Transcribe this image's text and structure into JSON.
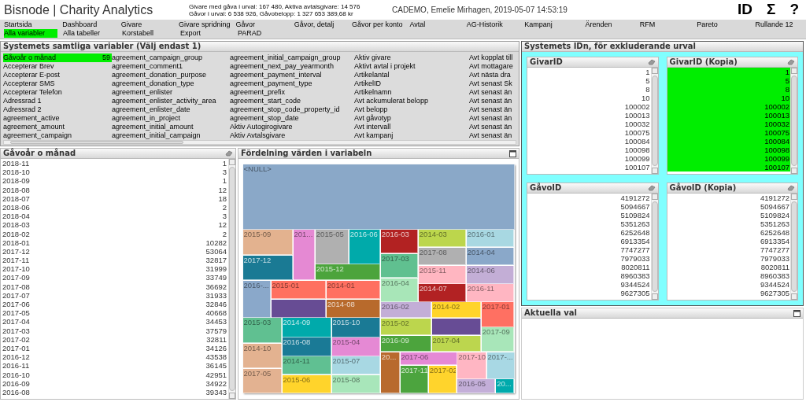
{
  "app": {
    "title": "Bisnode | Charity Analytics",
    "stats": [
      "Givare med gåva i urval: 167 480, Aktiva avtalsgivare: 14 576",
      "Gåvor i urval: 6 538 926, Gåvobelopp: 1 327 653 389,68 kr"
    ],
    "user": "CADEMO, Emelie Mirhagen, 2019-05-07 14:53:19",
    "tools": [
      "ID",
      "Σ",
      "?"
    ]
  },
  "menu": [
    [
      {
        "label": "Startsida",
        "selected": false
      },
      {
        "label": "Dashboard",
        "selected": false
      },
      {
        "label": "Givare",
        "selected": false
      },
      {
        "label": "Givare spridning",
        "selected": false
      },
      {
        "label": "Gåvor",
        "selected": false
      },
      {
        "label": "Gåvor, detalj",
        "selected": false
      },
      {
        "label": "Gåvor per konto",
        "selected": false
      },
      {
        "label": "Avtal",
        "selected": false
      },
      {
        "label": "AG-Historik",
        "selected": false
      },
      {
        "label": "Kampanj",
        "selected": false
      },
      {
        "label": "Ärenden",
        "selected": false
      },
      {
        "label": "RFM",
        "selected": false
      },
      {
        "label": "Pareto",
        "selected": false
      },
      {
        "label": "Rullande 12",
        "selected": false
      }
    ],
    [
      {
        "label": "Alla variabler",
        "selected": true
      },
      {
        "label": "Alla tabeller",
        "selected": false
      },
      {
        "label": "Korstabell",
        "selected": false
      },
      {
        "label": "Export",
        "selected": false
      },
      {
        "label": "PARAD",
        "selected": false
      }
    ]
  ],
  "variables": {
    "title": "Systemets samtliga variabler (Välj endast 1)",
    "columns": [
      [
        {
          "label": "Gåvoår o månad",
          "count": "59",
          "selected": true
        },
        {
          "label": "Accepterar Brev",
          "selected": false
        },
        {
          "label": "Accepterar E-post",
          "selected": false
        },
        {
          "label": "Accepterar SMS",
          "selected": false
        },
        {
          "label": "Accepterar Telefon",
          "selected": false
        },
        {
          "label": "Adressrad 1",
          "selected": false
        },
        {
          "label": "Adressrad 2",
          "selected": false
        },
        {
          "label": "agreement_active",
          "selected": false
        },
        {
          "label": "agreement_amount",
          "selected": false
        },
        {
          "label": "agreement_campaign",
          "selected": false
        }
      ],
      [
        {
          "label": "agreement_campaign_group",
          "selected": false
        },
        {
          "label": "agreement_comment1",
          "selected": false
        },
        {
          "label": "agreement_donation_purpose",
          "selected": false
        },
        {
          "label": "agreement_donation_type",
          "selected": false
        },
        {
          "label": "agreement_enlister",
          "selected": false
        },
        {
          "label": "agreement_enlister_activity_area",
          "selected": false
        },
        {
          "label": "agreement_enlister_date",
          "selected": false
        },
        {
          "label": "agreement_in_project",
          "selected": false
        },
        {
          "label": "agreement_initial_amount",
          "selected": false
        },
        {
          "label": "agreement_initial_campaign",
          "selected": false
        }
      ],
      [
        {
          "label": "agreement_initial_campaign_group",
          "selected": false
        },
        {
          "label": "agreement_next_pay_yearmonth",
          "selected": false
        },
        {
          "label": "agreement_payment_interval",
          "selected": false
        },
        {
          "label": "agreement_payment_type",
          "selected": false
        },
        {
          "label": "agreement_prefix",
          "selected": false
        },
        {
          "label": "agreement_start_code",
          "selected": false
        },
        {
          "label": "agreement_stop_code_property_id",
          "selected": false
        },
        {
          "label": "agreement_stop_date",
          "selected": false
        },
        {
          "label": "Aktiv Autogirogivare",
          "selected": false
        },
        {
          "label": "Aktiv Avtalsgivare",
          "selected": false
        }
      ],
      [
        {
          "label": "Aktiv givare",
          "selected": false
        },
        {
          "label": "Aktivt avtal i projekt",
          "selected": false
        },
        {
          "label": "Artikelantal",
          "selected": false
        },
        {
          "label": "ArtikelID",
          "selected": false
        },
        {
          "label": "Artikelnamn",
          "selected": false
        },
        {
          "label": "Avt ackumulerat belopp",
          "selected": false
        },
        {
          "label": "Avt belopp",
          "selected": false
        },
        {
          "label": "Avt gåvotyp",
          "selected": false
        },
        {
          "label": "Avt intervall",
          "selected": false
        },
        {
          "label": "Avt kampanj",
          "selected": false
        }
      ],
      [
        {
          "label": "Avt kopplat till",
          "selected": false
        },
        {
          "label": "Avt mottagare",
          "selected": false
        },
        {
          "label": "Avt nästa dra",
          "selected": false
        },
        {
          "label": "Avt senast Sk",
          "selected": false
        },
        {
          "label": "Avt senast än",
          "selected": false
        },
        {
          "label": "Avt senast än",
          "selected": false
        },
        {
          "label": "Avt senast än",
          "selected": false
        },
        {
          "label": "Avt senast än",
          "selected": false
        },
        {
          "label": "Avt senast än",
          "selected": false
        },
        {
          "label": "Avt senast än",
          "selected": false
        }
      ]
    ]
  },
  "month_list": {
    "title": "Gåvoår o månad",
    "rows": [
      {
        "label": "2018-11",
        "count": "1",
        "selected": false
      },
      {
        "label": "2018-10",
        "count": "3",
        "selected": false
      },
      {
        "label": "2018-09",
        "count": "1",
        "selected": false
      },
      {
        "label": "2018-08",
        "count": "12",
        "selected": false
      },
      {
        "label": "2018-07",
        "count": "18",
        "selected": false
      },
      {
        "label": "2018-06",
        "count": "2",
        "selected": false
      },
      {
        "label": "2018-04",
        "count": "3",
        "selected": false
      },
      {
        "label": "2018-03",
        "count": "12",
        "selected": false
      },
      {
        "label": "2018-02",
        "count": "2",
        "selected": false
      },
      {
        "label": "2018-01",
        "count": "10282",
        "selected": false
      },
      {
        "label": "2017-12",
        "count": "53064",
        "selected": false
      },
      {
        "label": "2017-11",
        "count": "32817",
        "selected": false
      },
      {
        "label": "2017-10",
        "count": "31999",
        "selected": false
      },
      {
        "label": "2017-09",
        "count": "33749",
        "selected": false
      },
      {
        "label": "2017-08",
        "count": "36692",
        "selected": false
      },
      {
        "label": "2017-07",
        "count": "31933",
        "selected": false
      },
      {
        "label": "2017-06",
        "count": "32846",
        "selected": false
      },
      {
        "label": "2017-05",
        "count": "40668",
        "selected": false
      },
      {
        "label": "2017-04",
        "count": "34453",
        "selected": false
      },
      {
        "label": "2017-03",
        "count": "37579",
        "selected": false
      },
      {
        "label": "2017-02",
        "count": "32811",
        "selected": false
      },
      {
        "label": "2017-01",
        "count": "34126",
        "selected": false
      },
      {
        "label": "2016-12",
        "count": "43538",
        "selected": false
      },
      {
        "label": "2016-11",
        "count": "36145",
        "selected": false
      },
      {
        "label": "2016-10",
        "count": "42951",
        "selected": false
      },
      {
        "label": "2016-09",
        "count": "34922",
        "selected": false
      },
      {
        "label": "2016-08",
        "count": "39343",
        "selected": false
      }
    ]
  },
  "treemap": {
    "title": "Fördelning värden i variabeln",
    "tiles": [
      {
        "label": "<NULL>",
        "color": "#8aa8c8"
      },
      {
        "label": "2015-09",
        "color": "#e3b28f"
      },
      {
        "label": "201...",
        "color": "#e589d3"
      },
      {
        "label": "2015-05",
        "color": "#b0b0b0"
      },
      {
        "label": "2016-06",
        "color": "#00aaaa"
      },
      {
        "label": "2016-03",
        "color": "#b22222"
      },
      {
        "label": "2014-03",
        "color": "#bcd64c"
      },
      {
        "label": "2016-01",
        "color": "#a8d8e2"
      },
      {
        "label": "2017-12",
        "color": "#1a7a94"
      },
      {
        "label": "2015-12",
        "color": "#4ca43c"
      },
      {
        "label": "2017-03",
        "color": "#60c090"
      },
      {
        "label": "2017-08",
        "color": "#b0b0b1"
      },
      {
        "label": "2014-04",
        "color": "#8aa8c9"
      },
      {
        "label": "2015-11",
        "color": "#ffb6c1"
      },
      {
        "label": "2014-06",
        "color": "#c3aed6"
      },
      {
        "label": "2016-...",
        "color": "#8aa8ca"
      },
      {
        "label": "2015-01",
        "color": "#ff7060"
      },
      {
        "label": "2014-01",
        "color": "#ff7061"
      },
      {
        "label": "2016-04",
        "color": "#a8e6b8"
      },
      {
        "label": "2014-07",
        "color": "#b22223"
      },
      {
        "label": "2016-11",
        "color": "#ffb6c2"
      },
      {
        "color": "#674c94"
      },
      {
        "label": "2014-08",
        "color": "#b86a2c"
      },
      {
        "label": "2016-02",
        "color": "#c3aed7"
      },
      {
        "label": "2014-02",
        "color": "#ffd42a"
      },
      {
        "label": "2017-01",
        "color": "#ff7062"
      },
      {
        "label": "2015-03",
        "color": "#60c091"
      },
      {
        "label": "2014-09",
        "color": "#00aaab"
      },
      {
        "label": "2015-10",
        "color": "#1a7a95"
      },
      {
        "label": "2015-02",
        "color": "#bcd64d"
      },
      {
        "color": "#674c95"
      },
      {
        "label": "2017-09",
        "color": "#a8e6b9"
      },
      {
        "label": "2016-08",
        "color": "#1a7a96"
      },
      {
        "label": "2015-04",
        "color": "#e589d4"
      },
      {
        "label": "2016-09",
        "color": "#4ca43d"
      },
      {
        "label": "2017-04",
        "color": "#bcd64e"
      },
      {
        "label": "2014-10",
        "color": "#e3b290"
      },
      {
        "label": "2014-11",
        "color": "#60c092"
      },
      {
        "label": "2015-07",
        "color": "#a8d8e3"
      },
      {
        "label": "20...",
        "color": "#b86a2d"
      },
      {
        "label": "2017-06",
        "color": "#e589d5"
      },
      {
        "label": "2017-10",
        "color": "#ffb6c3"
      },
      {
        "label": "2017-...",
        "color": "#a8d8e4"
      },
      {
        "label": "2017-05",
        "color": "#e3b291"
      },
      {
        "label": "2015-06",
        "color": "#ffd42b"
      },
      {
        "label": "2015-08",
        "color": "#a8e6ba"
      },
      {
        "label": "2017-11",
        "color": "#4ca43e"
      },
      {
        "label": "2017-02",
        "color": "#ffd42c"
      },
      {
        "label": "2016-05",
        "color": "#c3aed8"
      },
      {
        "label": "20...",
        "color": "#00aaac"
      }
    ]
  },
  "id_panel": {
    "title": "Systemets IDn, för exkluderande urval",
    "lists": [
      {
        "title": "GivarID",
        "rows": [
          {
            "value": "1",
            "selected": false
          },
          {
            "value": "5",
            "selected": false
          },
          {
            "value": "8",
            "selected": false
          },
          {
            "value": "10",
            "selected": false
          },
          {
            "value": "100002",
            "selected": false
          },
          {
            "value": "100013",
            "selected": false
          },
          {
            "value": "100032",
            "selected": false
          },
          {
            "value": "100075",
            "selected": false
          },
          {
            "value": "100084",
            "selected": false
          },
          {
            "value": "100098",
            "selected": false
          },
          {
            "value": "100099",
            "selected": false
          },
          {
            "value": "100107",
            "selected": false
          }
        ]
      },
      {
        "title": "GivarID (Kopia)",
        "rows": [
          {
            "value": "1",
            "selected": true
          },
          {
            "value": "5",
            "selected": true
          },
          {
            "value": "8",
            "selected": true
          },
          {
            "value": "10",
            "selected": true
          },
          {
            "value": "100002",
            "selected": true
          },
          {
            "value": "100013",
            "selected": true
          },
          {
            "value": "100032",
            "selected": true
          },
          {
            "value": "100075",
            "selected": true
          },
          {
            "value": "100084",
            "selected": true
          },
          {
            "value": "100098",
            "selected": true
          },
          {
            "value": "100099",
            "selected": true
          },
          {
            "value": "100107",
            "selected": true
          }
        ]
      },
      {
        "title": "GåvoID",
        "rows": [
          {
            "value": "4191272",
            "selected": false
          },
          {
            "value": "5094667",
            "selected": false
          },
          {
            "value": "5109824",
            "selected": false
          },
          {
            "value": "5351263",
            "selected": false
          },
          {
            "value": "6252648",
            "selected": false
          },
          {
            "value": "6913354",
            "selected": false
          },
          {
            "value": "7747277",
            "selected": false
          },
          {
            "value": "7979033",
            "selected": false
          },
          {
            "value": "8020811",
            "selected": false
          },
          {
            "value": "8960383",
            "selected": false
          },
          {
            "value": "9344524",
            "selected": false
          },
          {
            "value": "9627305",
            "selected": false
          }
        ]
      },
      {
        "title": "GåvoID (Kopia)",
        "rows": [
          {
            "value": "4191272",
            "selected": false
          },
          {
            "value": "5094667",
            "selected": false
          },
          {
            "value": "5109824",
            "selected": false
          },
          {
            "value": "5351263",
            "selected": false
          },
          {
            "value": "6252648",
            "selected": false
          },
          {
            "value": "6913354",
            "selected": false
          },
          {
            "value": "7747277",
            "selected": false
          },
          {
            "value": "7979033",
            "selected": false
          },
          {
            "value": "8020811",
            "selected": false
          },
          {
            "value": "8960383",
            "selected": false
          },
          {
            "value": "9344524",
            "selected": false
          },
          {
            "value": "9627305",
            "selected": false
          }
        ]
      }
    ]
  },
  "current_selections": {
    "title": "Aktuella val"
  }
}
